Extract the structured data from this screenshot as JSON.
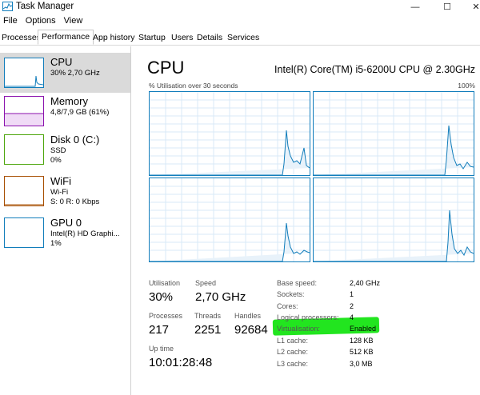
{
  "window": {
    "title": "Task Manager",
    "minimize_glyph": "—",
    "maximize_glyph": "☐",
    "close_glyph": "✕"
  },
  "menu": [
    "File",
    "Options",
    "View"
  ],
  "tabs": [
    "Processes",
    "Performance",
    "App history",
    "Startup",
    "Users",
    "Details",
    "Services"
  ],
  "active_tab": "Performance",
  "sidebar": {
    "items": [
      {
        "title": "CPU",
        "line1": "30% 2,70 GHz",
        "line2": "",
        "color": "#117dbb",
        "icon": "cpu-thumbnail-icon"
      },
      {
        "title": "Memory",
        "line1": "4,8/7,9 GB (61%)",
        "line2": "",
        "color": "#8b12ae",
        "icon": "memory-thumbnail-icon"
      },
      {
        "title": "Disk 0 (C:)",
        "line1": "SSD",
        "line2": "0%",
        "color": "#4da60c",
        "icon": "disk-thumbnail-icon"
      },
      {
        "title": "WiFi",
        "line1": "Wi-Fi",
        "line2": "S: 0 R: 0 Kbps",
        "color": "#a74f01",
        "icon": "wifi-thumbnail-icon"
      },
      {
        "title": "GPU 0",
        "line1": "Intel(R) HD Graphi...",
        "line2": "1%",
        "color": "#117dbb",
        "icon": "gpu-thumbnail-icon"
      }
    ]
  },
  "main": {
    "title": "CPU",
    "model": "Intel(R) Core(TM) i5-6200U CPU @ 2.30GHz",
    "graph_label": "% Utilisation over 30 seconds",
    "graph_max": "100%",
    "accent": "#117dbb",
    "stats": {
      "utilisation_label": "Utilisation",
      "utilisation_value": "30%",
      "speed_label": "Speed",
      "speed_value": "2,70 GHz",
      "processes_label": "Processes",
      "processes_value": "217",
      "threads_label": "Threads",
      "threads_value": "2251",
      "handles_label": "Handles",
      "handles_value": "92684",
      "uptime_label": "Up time",
      "uptime_value": "10:01:28:48"
    },
    "details": [
      {
        "label": "Base speed:",
        "value": "2,40 GHz"
      },
      {
        "label": "Sockets:",
        "value": "1"
      },
      {
        "label": "Cores:",
        "value": "2"
      },
      {
        "label": "Logical processors:",
        "value": "4"
      },
      {
        "label": "Virtualisation:",
        "value": "Enabled"
      },
      {
        "label": "L1 cache:",
        "value": "128 KB"
      },
      {
        "label": "L2 cache:",
        "value": "512 KB"
      },
      {
        "label": "L3 cache:",
        "value": "3,0 MB"
      }
    ],
    "highlight_color": "#22e51f"
  }
}
